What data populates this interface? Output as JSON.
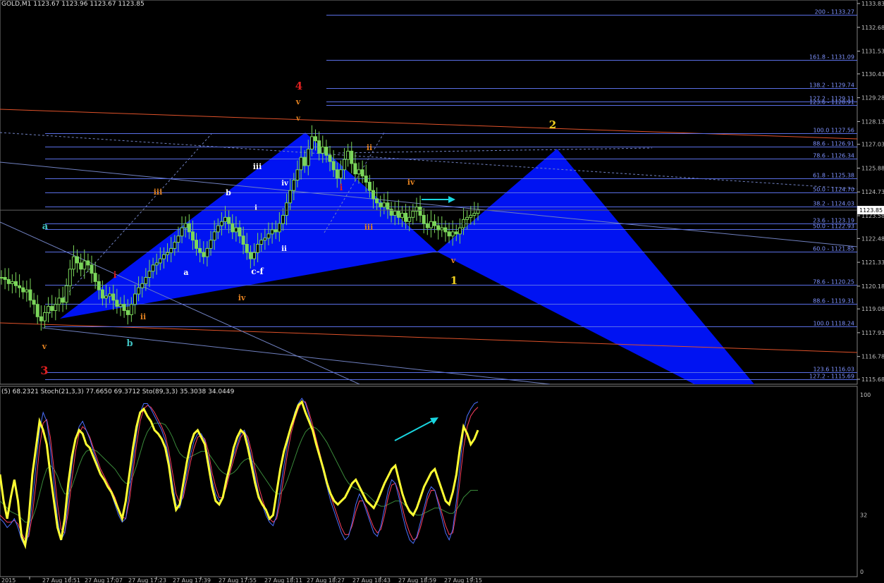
{
  "header": {
    "main_info": "GOLD,M1  1123.67 1123.96 1123.67 1123.85",
    "osc_info": "(5) 68.2321  Stoch(21,3,3) 77.6650 69.3712  Sto(89,3,3) 35.3038 34.0449"
  },
  "colors": {
    "background": "#000000",
    "axis": "#c0c0c0",
    "fib_line": "#5a6fe6",
    "fib_label": "#7f93ff",
    "candle": "#7bd65a",
    "pattern_fill": "#0014ff",
    "channel": "#e0522a",
    "trend": "#7080c0",
    "arrow": "#19d6e0",
    "stoch_yellow": "#ffff33",
    "stoch_blue": "#4a6fff",
    "stoch_red": "#ff4060",
    "stoch_green": "#3a8a3a"
  },
  "chart_data": [
    {
      "type": "candlestick",
      "symbol": "GOLD,M1",
      "ylim": [
        1115.68,
        1133.83
      ],
      "y_ticks": [
        "1133.83",
        "1132.68",
        "1131.53",
        "1130.43",
        "1129.28",
        "1128.13",
        "1127.03",
        "1125.88",
        "1124.73",
        "1123.58",
        "1122.48",
        "1121.33",
        "1120.18",
        "1119.08",
        "1117.93",
        "1116.78",
        "1115.68"
      ],
      "current_price": "1123.85",
      "x_ticks": [
        "2015",
        "27 Aug 16:51",
        "27 Aug 17:07",
        "27 Aug 17:23",
        "27 Aug 17:39",
        "27 Aug 17:55",
        "27 Aug 18:11",
        "27 Aug 18:27",
        "27 Aug 18:43",
        "27 Aug 18:59",
        "27 Aug 19:15"
      ],
      "close_series": [
        1120.6,
        1120.5,
        1120.3,
        1120.4,
        1120.2,
        1120.1,
        1119.9,
        1120.0,
        1119.5,
        1119.3,
        1118.7,
        1118.5,
        1118.9,
        1119.2,
        1119.0,
        1119.3,
        1119.6,
        1119.4,
        1120.2,
        1121.0,
        1121.6,
        1121.3,
        1121.0,
        1121.4,
        1121.2,
        1120.8,
        1120.4,
        1120.0,
        1119.6,
        1119.7,
        1119.8,
        1119.5,
        1119.2,
        1119.3,
        1119.0,
        1118.8,
        1119.3,
        1119.8,
        1120.1,
        1120.3,
        1120.6,
        1120.9,
        1121.2,
        1121.3,
        1121.5,
        1121.7,
        1121.8,
        1122.0,
        1122.3,
        1122.6,
        1123.0,
        1123.2,
        1122.8,
        1122.4,
        1122.0,
        1121.8,
        1121.6,
        1122.0,
        1122.4,
        1122.8,
        1123.1,
        1123.3,
        1123.5,
        1123.2,
        1122.8,
        1123.0,
        1122.6,
        1122.2,
        1121.8,
        1121.5,
        1121.8,
        1122.2,
        1122.4,
        1122.5,
        1122.7,
        1122.9,
        1122.8,
        1123.2,
        1123.6,
        1124.2,
        1124.8,
        1125.3,
        1125.8,
        1126.4,
        1126.0,
        1126.8,
        1127.4,
        1127.2,
        1126.6,
        1126.9,
        1126.5,
        1126.2,
        1125.8,
        1125.4,
        1125.8,
        1126.3,
        1126.7,
        1126.1,
        1125.6,
        1125.8,
        1125.5,
        1125.2,
        1124.8,
        1124.4,
        1124.2,
        1124.0,
        1124.2,
        1123.9,
        1123.6,
        1123.8,
        1123.5,
        1123.7,
        1123.3,
        1123.5,
        1123.8,
        1124.0,
        1123.6,
        1123.2,
        1123.0,
        1123.3,
        1123.1,
        1122.9,
        1123.0,
        1122.8,
        1122.6,
        1122.8,
        1122.7,
        1123.0,
        1123.4,
        1123.5,
        1123.6,
        1123.7,
        1123.85
      ],
      "fib_levels": [
        {
          "label": "200 - 1133.27",
          "value": 1133.27
        },
        {
          "label": "161.8 - 1131.09",
          "value": 1131.09
        },
        {
          "label": "138.2 - 1129.74",
          "value": 1129.74
        },
        {
          "label": "127.2 - 1129.11",
          "value": 1129.11
        },
        {
          "label": "123.6 - 1128.91",
          "value": 1128.91
        },
        {
          "label": "100.0 1127.56",
          "value": 1127.56
        },
        {
          "label": "88.6 - 1126.91",
          "value": 1126.91
        },
        {
          "label": "78.6 - 1126.34",
          "value": 1126.34
        },
        {
          "label": "61.8 - 1125.38",
          "value": 1125.38
        },
        {
          "label": "50.0 - 1124.70",
          "value": 1124.7
        },
        {
          "label": "38.2 - 1124.03",
          "value": 1124.03
        },
        {
          "label": "23.6 - 1123.19",
          "value": 1123.19
        },
        {
          "label": "50.0 - 1122.93",
          "value": 1122.93
        },
        {
          "label": "60.0 - 1121.85",
          "value": 1121.85
        },
        {
          "label": "78.6 - 1120.25",
          "value": 1120.25
        },
        {
          "label": "88.6 - 1119.31",
          "value": 1119.31
        },
        {
          "label": "100.0 1118.24",
          "value": 1118.24
        },
        {
          "label": "123.6 1116.03",
          "value": 1116.03
        },
        {
          "label": "127.2 - 1115.69",
          "value": 1115.69
        }
      ],
      "wave_labels": [
        {
          "text": "4",
          "color": "#e02020"
        },
        {
          "text": "v",
          "color": "#e08020"
        },
        {
          "text": "v",
          "color": "#e08020"
        },
        {
          "text": "2",
          "color": "#f0d020"
        },
        {
          "text": "ii",
          "color": "#e08020"
        },
        {
          "text": "iii",
          "color": "#e08020"
        },
        {
          "text": "iii",
          "color": "#ffffff"
        },
        {
          "text": "b",
          "color": "#ffffff"
        },
        {
          "text": "iv",
          "color": "#ffffff"
        },
        {
          "text": "i",
          "color": "#e02020"
        },
        {
          "text": "iv",
          "color": "#e08020"
        },
        {
          "text": "i",
          "color": "#ffffff"
        },
        {
          "text": "a",
          "color": "#40c0c0"
        },
        {
          "text": "ii",
          "color": "#ffffff"
        },
        {
          "text": "iii",
          "color": "#e08020"
        },
        {
          "text": "i",
          "color": "#e02020"
        },
        {
          "text": "a",
          "color": "#ffffff"
        },
        {
          "text": "c-f",
          "color": "#ffffff"
        },
        {
          "text": "v",
          "color": "#e08020"
        },
        {
          "text": "1",
          "color": "#f0d020"
        },
        {
          "text": "iv",
          "color": "#e08020"
        },
        {
          "text": "ii",
          "color": "#e08020"
        },
        {
          "text": "v",
          "color": "#e08020"
        },
        {
          "text": "b",
          "color": "#40c0c0"
        },
        {
          "text": "3",
          "color": "#e02020"
        }
      ]
    },
    {
      "type": "line",
      "name": "Stochastic",
      "ylim": [
        0,
        100
      ],
      "y_ticks": [
        "100",
        "32",
        "0"
      ],
      "series": [
        {
          "color": "#ffff33",
          "values": [
            55,
            40,
            30,
            42,
            52,
            40,
            20,
            15,
            30,
            55,
            70,
            85,
            80,
            72,
            55,
            40,
            25,
            18,
            30,
            50,
            65,
            75,
            80,
            78,
            72,
            70,
            65,
            60,
            55,
            52,
            48,
            45,
            40,
            35,
            30,
            40,
            55,
            70,
            82,
            90,
            92,
            88,
            85,
            80,
            78,
            75,
            70,
            60,
            45,
            35,
            38,
            50,
            62,
            72,
            78,
            80,
            76,
            72,
            60,
            48,
            40,
            38,
            42,
            52,
            60,
            70,
            76,
            80,
            78,
            70,
            60,
            50,
            42,
            38,
            35,
            30,
            32,
            45,
            58,
            68,
            75,
            82,
            88,
            94,
            96,
            90,
            85,
            80,
            72,
            65,
            58,
            50,
            44,
            40,
            38,
            40,
            42,
            46,
            50,
            52,
            48,
            44,
            40,
            38,
            36,
            40,
            45,
            50,
            54,
            58,
            60,
            52,
            44,
            38,
            34,
            32,
            36,
            42,
            48,
            52,
            56,
            58,
            52,
            46,
            40,
            38,
            45,
            55,
            70,
            82,
            78,
            72,
            75,
            80
          ]
        },
        {
          "color": "#4a6fff",
          "values": [
            30,
            28,
            25,
            27,
            30,
            25,
            18,
            14,
            22,
            40,
            60,
            80,
            90,
            85,
            70,
            50,
            30,
            18,
            22,
            40,
            60,
            75,
            82,
            85,
            80,
            75,
            68,
            62,
            56,
            52,
            48,
            44,
            38,
            32,
            28,
            30,
            45,
            62,
            78,
            90,
            95,
            95,
            92,
            88,
            84,
            80,
            74,
            64,
            50,
            38,
            36,
            44,
            56,
            66,
            74,
            78,
            78,
            74,
            64,
            52,
            44,
            40,
            42,
            50,
            58,
            66,
            72,
            78,
            80,
            74,
            64,
            54,
            44,
            38,
            32,
            28,
            26,
            32,
            46,
            60,
            72,
            82,
            90,
            95,
            98,
            95,
            88,
            80,
            72,
            64,
            56,
            48,
            40,
            34,
            28,
            22,
            18,
            20,
            28,
            38,
            44,
            40,
            34,
            28,
            22,
            20,
            26,
            36,
            46,
            52,
            50,
            42,
            32,
            24,
            18,
            16,
            20,
            28,
            36,
            44,
            48,
            46,
            38,
            30,
            22,
            18,
            24,
            40,
            60,
            80,
            88,
            92,
            95,
            96
          ]
        },
        {
          "color": "#ff4060",
          "values": [
            32,
            30,
            28,
            28,
            29,
            27,
            22,
            18,
            20,
            32,
            50,
            70,
            84,
            86,
            76,
            58,
            38,
            24,
            22,
            34,
            52,
            68,
            78,
            82,
            80,
            76,
            70,
            64,
            58,
            54,
            50,
            46,
            42,
            36,
            31,
            30,
            40,
            56,
            72,
            85,
            92,
            94,
            93,
            90,
            86,
            82,
            77,
            68,
            56,
            44,
            39,
            42,
            52,
            62,
            70,
            76,
            77,
            75,
            68,
            56,
            48,
            42,
            42,
            48,
            56,
            63,
            70,
            76,
            79,
            76,
            68,
            58,
            48,
            41,
            35,
            30,
            28,
            30,
            40,
            54,
            67,
            78,
            86,
            92,
            96,
            96,
            90,
            83,
            75,
            67,
            59,
            51,
            43,
            37,
            31,
            25,
            21,
            21,
            26,
            34,
            40,
            40,
            36,
            30,
            25,
            22,
            24,
            32,
            42,
            49,
            50,
            45,
            36,
            28,
            22,
            18,
            19,
            25,
            33,
            41,
            46,
            46,
            40,
            33,
            26,
            21,
            22,
            34,
            52,
            70,
            82,
            88,
            91,
            93
          ]
        },
        {
          "color": "#3a8a3a",
          "values": [
            40,
            38,
            36,
            34,
            33,
            32,
            30,
            28,
            28,
            30,
            36,
            44,
            52,
            58,
            60,
            58,
            54,
            48,
            44,
            44,
            48,
            54,
            60,
            65,
            68,
            69,
            69,
            68,
            66,
            64,
            62,
            60,
            58,
            55,
            52,
            50,
            50,
            54,
            60,
            67,
            74,
            79,
            82,
            84,
            84,
            84,
            83,
            80,
            76,
            71,
            67,
            65,
            64,
            65,
            66,
            67,
            68,
            68,
            67,
            64,
            61,
            58,
            56,
            55,
            55,
            56,
            58,
            61,
            63,
            64,
            63,
            61,
            58,
            55,
            52,
            49,
            46,
            44,
            44,
            47,
            52,
            58,
            64,
            70,
            75,
            79,
            81,
            82,
            81,
            79,
            76,
            73,
            69,
            65,
            61,
            57,
            53,
            50,
            48,
            47,
            46,
            45,
            44,
            42,
            40,
            38,
            37,
            37,
            38,
            39,
            40,
            40,
            39,
            37,
            35,
            33,
            32,
            32,
            33,
            34,
            35,
            36,
            36,
            35,
            34,
            33,
            33,
            35,
            38,
            42,
            44,
            46,
            46,
            46
          ]
        }
      ]
    }
  ]
}
